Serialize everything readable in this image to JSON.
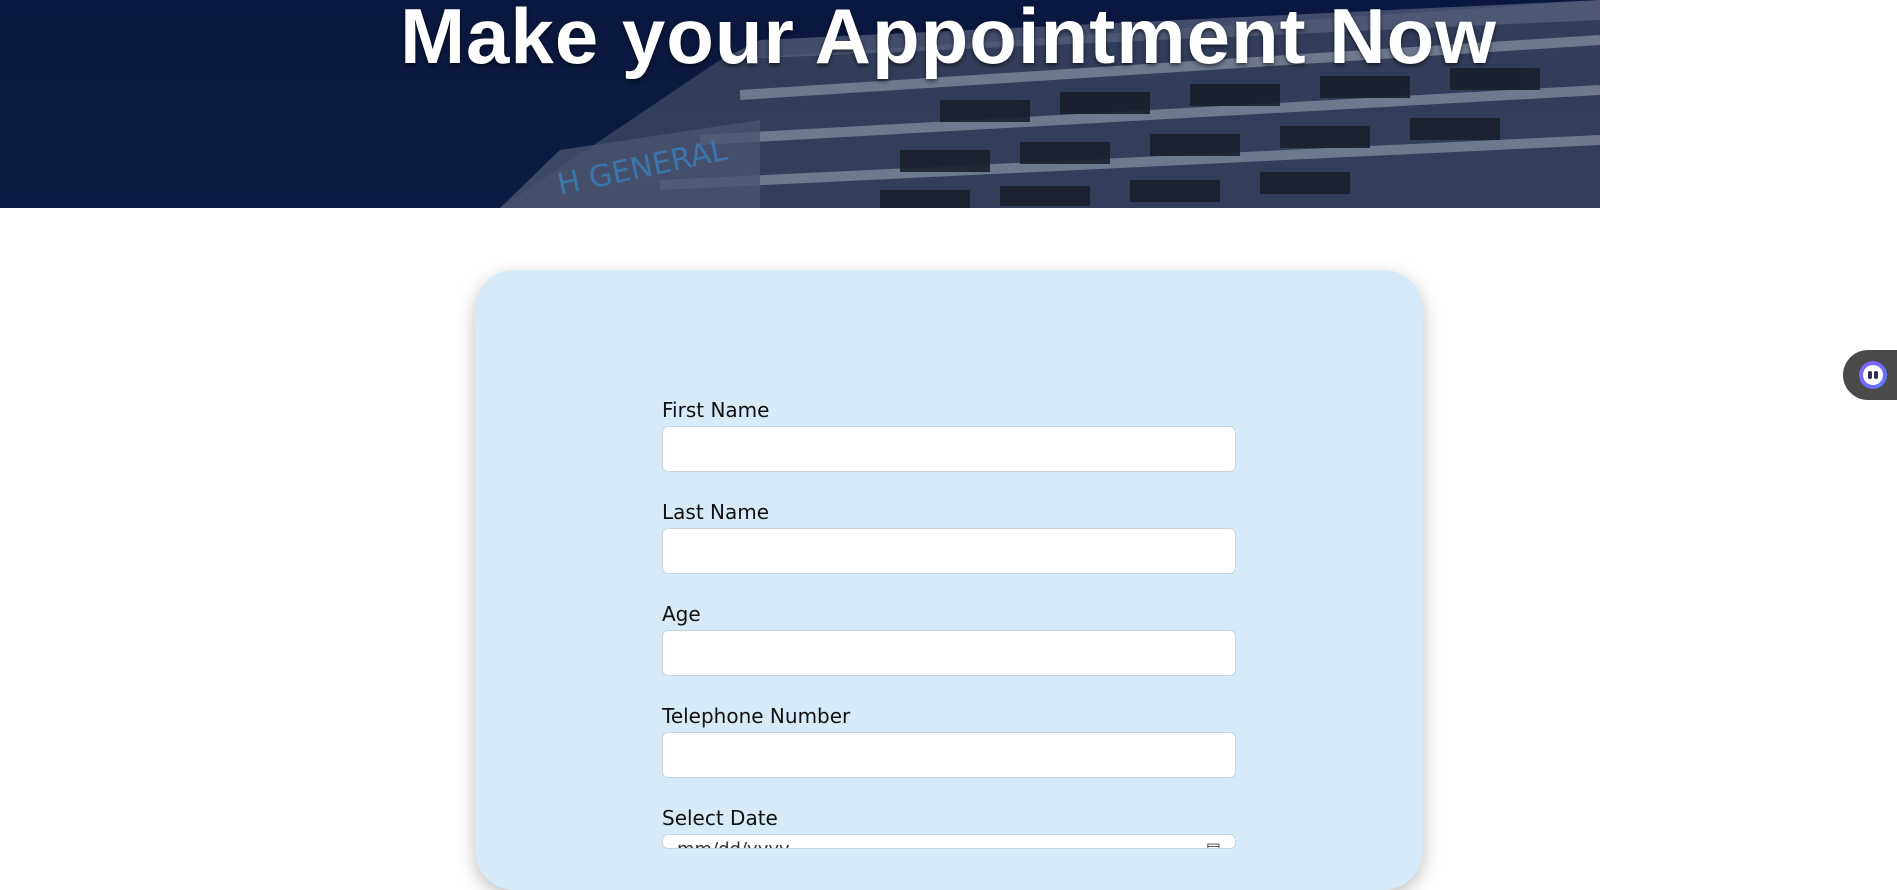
{
  "hero": {
    "title": "Make your Appointment Now",
    "building_sign": "H GENERAL"
  },
  "form": {
    "fields": [
      {
        "label": "First Name",
        "value": ""
      },
      {
        "label": "Last Name",
        "value": ""
      },
      {
        "label": "Age",
        "value": ""
      },
      {
        "label": "Telephone Number",
        "value": ""
      },
      {
        "label": "Select Date",
        "value": "mm/dd/yyyy"
      }
    ]
  },
  "colors": {
    "hero_overlay": "#0b1a3f",
    "card_background": "#d6ebf7",
    "input_background": "#ffffff",
    "widget_background": "#4a4a4a"
  },
  "icons": {
    "calendar": "calendar-icon",
    "assistant": "assistant-bot-icon"
  }
}
